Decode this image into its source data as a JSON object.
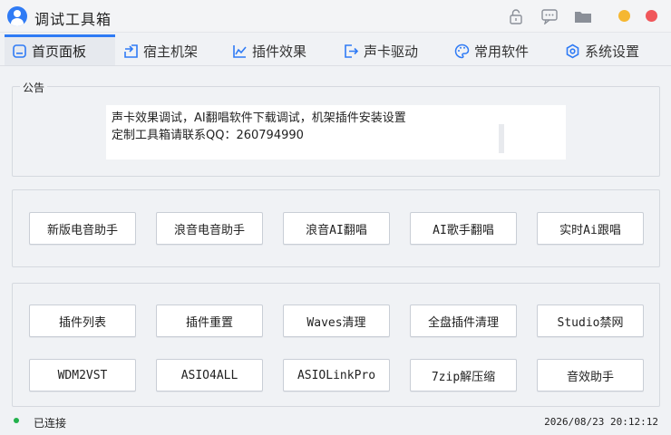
{
  "window": {
    "title": "调试工具箱",
    "accent_color": "#2f7bf5",
    "controls": {
      "minimize_color": "#f5b731",
      "close_color": "#f0575b"
    }
  },
  "titlebar_icons": [
    "lock-icon",
    "chat-icon",
    "folder-icon"
  ],
  "tabs": [
    {
      "label": "首页面板",
      "icon": "home-icon",
      "active": true
    },
    {
      "label": "宿主机架",
      "icon": "import-icon",
      "active": false
    },
    {
      "label": "插件效果",
      "icon": "chart-line-icon",
      "active": false
    },
    {
      "label": "声卡驱动",
      "icon": "export-icon",
      "active": false
    },
    {
      "label": "常用软件",
      "icon": "palette-icon",
      "active": false
    },
    {
      "label": "系统设置",
      "icon": "gear-icon",
      "active": false
    }
  ],
  "notice": {
    "legend": "公告",
    "lines": [
      "声卡效果调试，AI翻唱软件下载调试，机架插件安装设置",
      "定制工具箱请联系QQ：260794990"
    ]
  },
  "button_group_1": [
    "新版电音助手",
    "浪音电音助手",
    "浪音AI翻唱",
    "AI歌手翻唱",
    "实时Ai跟唱"
  ],
  "button_group_2": [
    [
      "插件列表",
      "插件重置",
      "Waves清理",
      "全盘插件清理",
      "Studio禁网"
    ],
    [
      "WDM2VST",
      "ASIO4ALL",
      "ASIOLinkPro",
      "7zip解压缩",
      "音效助手"
    ]
  ],
  "status": {
    "text": "已连接",
    "indicator_color": "#22b14c",
    "datetime": "2026/08/23 20:12:12"
  }
}
